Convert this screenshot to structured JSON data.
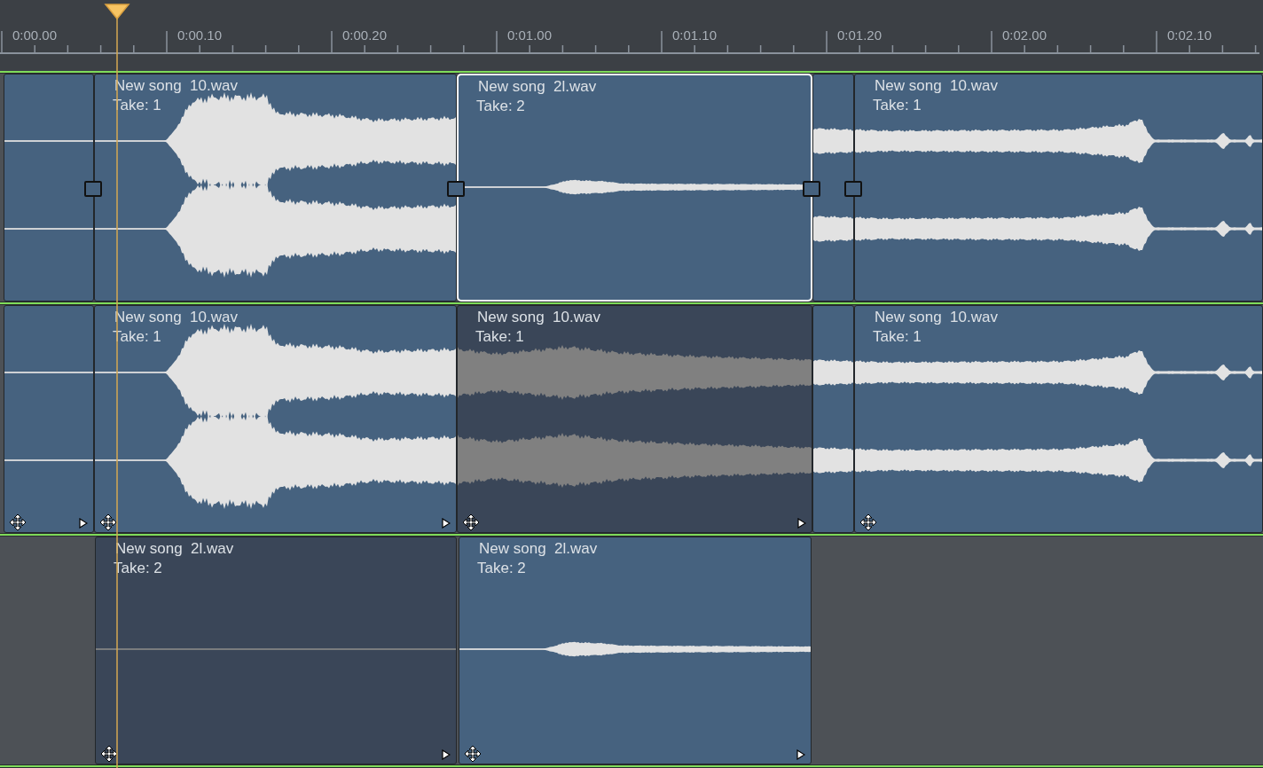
{
  "ruler": {
    "labels": [
      "0:00.00",
      "0:00.10",
      "0:00.20",
      "0:01.00",
      "0:01.10",
      "0:01.20",
      "0:02.00",
      "0:02.10"
    ]
  },
  "tracks": [
    {
      "move_handles": false,
      "fade_handles": true,
      "clips": [
        {
          "kind": "loud",
          "active": true,
          "selected": false
        },
        {
          "name": "New song  10.wav",
          "take": "Take: 1",
          "kind": "loud",
          "active": true,
          "selected": false
        },
        {
          "name": "New song  2l.wav",
          "take": "Take: 2",
          "kind": "quiet",
          "active": true,
          "selected": true
        },
        {
          "kind": "loud",
          "active": true,
          "selected": false
        },
        {
          "name": "New song  10.wav",
          "take": "Take: 1",
          "kind": "loud",
          "active": true,
          "selected": false
        }
      ]
    },
    {
      "move_handles": true,
      "fade_handles": false,
      "clips": [
        {
          "kind": "loud",
          "active": true,
          "selected": false
        },
        {
          "name": "New song  10.wav",
          "take": "Take: 1",
          "kind": "loud",
          "active": true,
          "selected": false
        },
        {
          "name": "New song  10.wav",
          "take": "Take: 1",
          "kind": "loud",
          "active": false,
          "selected": false
        },
        {
          "kind": "loud",
          "active": true,
          "selected": false
        },
        {
          "name": "New song  10.wav",
          "take": "Take: 1",
          "kind": "loud",
          "active": true,
          "selected": false
        }
      ]
    },
    {
      "move_handles": true,
      "fade_handles": false,
      "clips": [
        {
          "name": "New song  2l.wav",
          "take": "Take: 2",
          "kind": "quiet",
          "active": false,
          "selected": false
        },
        {
          "name": "New song  2l.wav",
          "take": "Take: 2",
          "kind": "quiet",
          "active": true,
          "selected": false
        }
      ]
    }
  ]
}
